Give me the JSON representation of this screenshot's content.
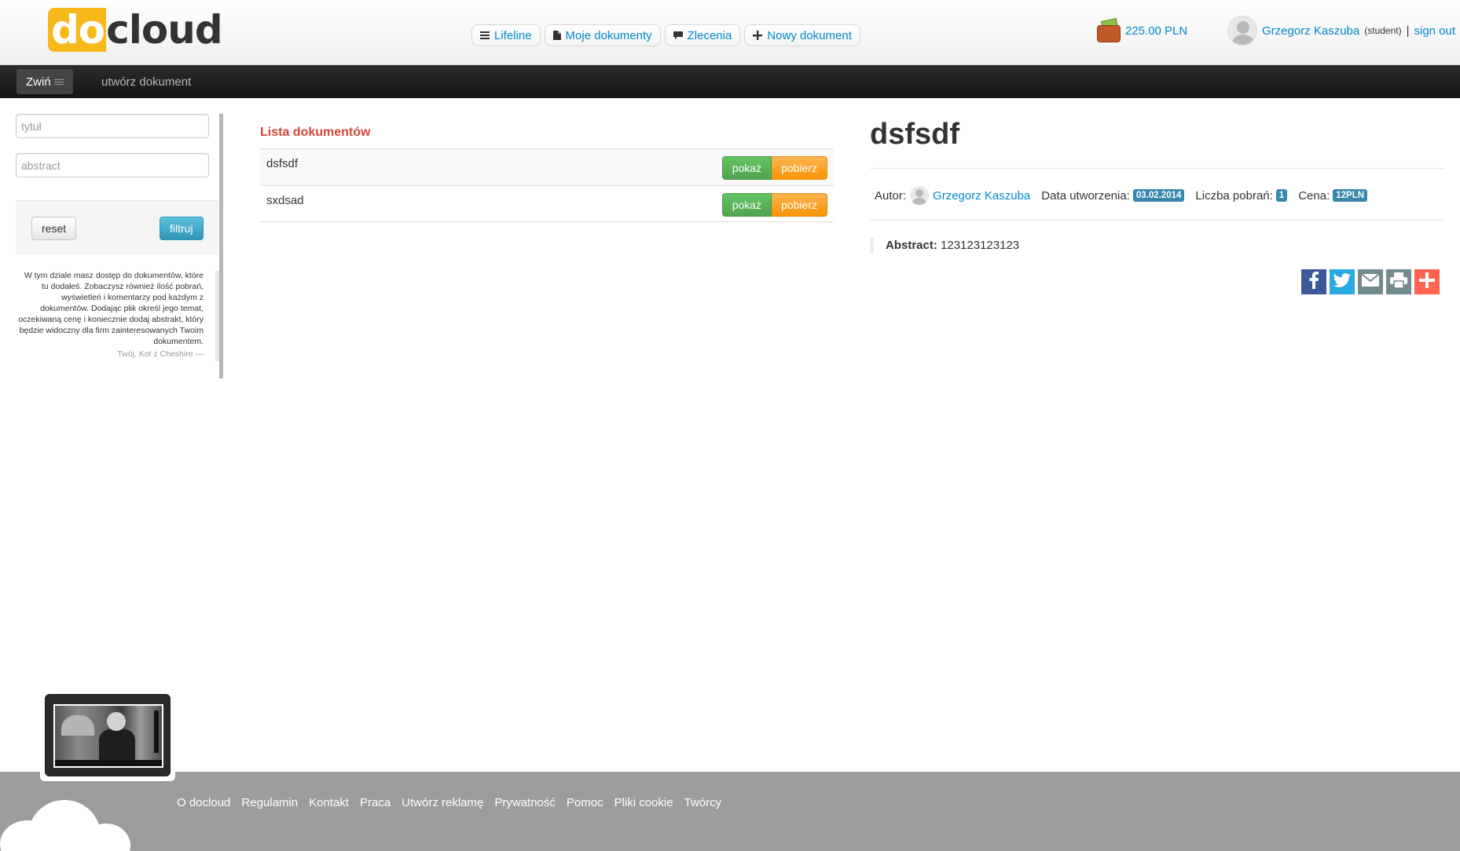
{
  "header": {
    "logo": {
      "part1": "do",
      "part2": "cloud"
    },
    "nav": [
      {
        "label": "Lifeline",
        "icon": "list-icon"
      },
      {
        "label": "Moje dokumenty",
        "icon": "document-icon"
      },
      {
        "label": "Zlecenia",
        "icon": "comment-icon"
      },
      {
        "label": "Nowy dokument",
        "icon": "plus-icon"
      }
    ],
    "wallet": {
      "amount": "225.00 PLN",
      "icon": "wallet-icon"
    },
    "user": {
      "name": "Grzegorz Kaszuba",
      "role": "(student)",
      "separator": "|",
      "signout": "sign out"
    }
  },
  "subnav": {
    "toggle_label": "Zwiń",
    "create_label": "utwórz dokument"
  },
  "sidebar": {
    "title_placeholder": "tytuł",
    "abstract_placeholder": "abstract",
    "reset_label": "reset",
    "filter_label": "filtruj",
    "blurb": "W tym dziale masz dostęp do dokumentów, które tu dodałeś. Zobaczysz również ilość pobrań, wyświetleń i komentarzy pod każdym z dokumentów. Dodając plik określ jego temat, oczekiwaną cenę i koniecznie dodaj abstrakt, który będzie widoczny dla firm zainteresowanych Twoim dokumentem.",
    "signature": "Twój, Kot z Cheshire —"
  },
  "doclist": {
    "heading": "Lista dokumentów",
    "rows": [
      {
        "title": "dsfsdf",
        "show_label": "pokaż",
        "download_label": "pobierz"
      },
      {
        "title": "sxdsad",
        "show_label": "pokaż",
        "download_label": "pobierz"
      }
    ]
  },
  "detail": {
    "title": "dsfsdf",
    "author_label": "Autor:",
    "author_name": "Grzegorz Kaszuba",
    "created_label": "Data utworzenia:",
    "created_value": "03.02.2014",
    "downloads_label": "Liczba pobrań:",
    "downloads_value": "1",
    "price_label": "Cena:",
    "price_value": "12PLN",
    "abstract_label": "Abstract:",
    "abstract_value": "123123123123",
    "share": [
      "facebook-icon",
      "twitter-icon",
      "email-icon",
      "print-icon",
      "plus-share-icon"
    ]
  },
  "footer": {
    "links": [
      "O docloud",
      "Regulamin",
      "Kontakt",
      "Praca",
      "Utwórz reklamę",
      "Prywatność",
      "Pomoc",
      "Pliki cookie",
      "Twórcy"
    ]
  },
  "colors": {
    "link": "#0088cc",
    "heading_red": "#d14836",
    "badge": "#3a87ad",
    "logo_yellow": "#f7b81a",
    "footer_bg": "#9c9c9c",
    "btn_green": "#51a351",
    "btn_orange": "#f89406"
  }
}
